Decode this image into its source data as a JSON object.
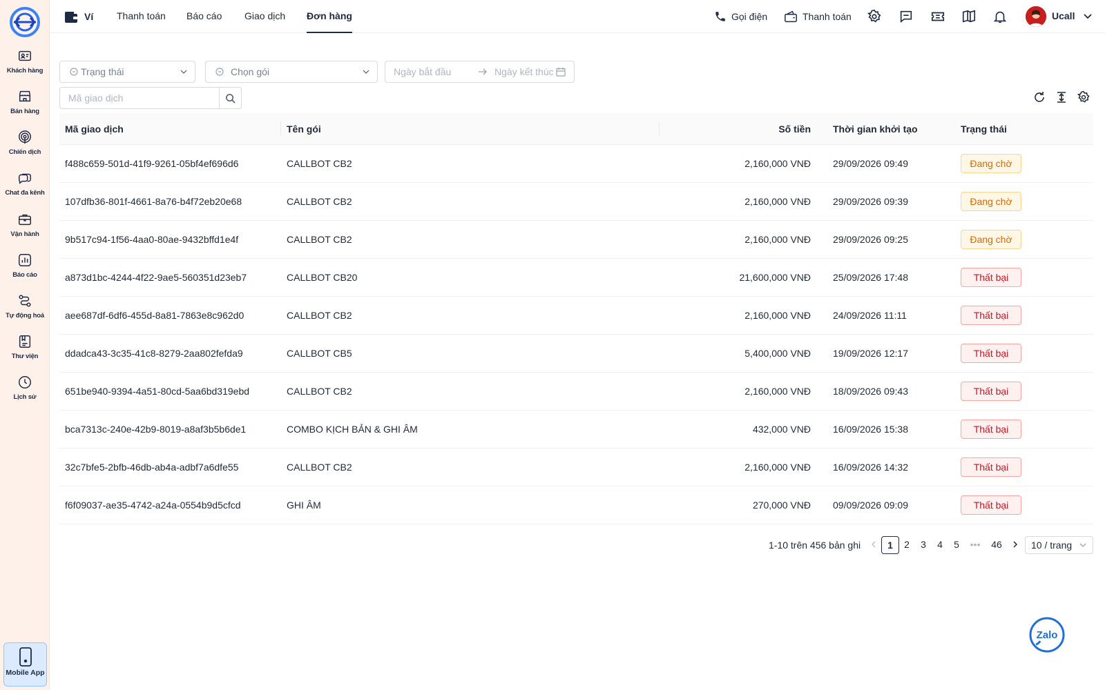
{
  "sidebar": {
    "items": [
      {
        "label": "Khách hàng",
        "icon": "customer-card-icon"
      },
      {
        "label": "Bán hàng",
        "icon": "store-icon"
      },
      {
        "label": "Chiến dịch",
        "icon": "broadcast-icon"
      },
      {
        "label": "Chat đa kênh",
        "icon": "chat-icon"
      },
      {
        "label": "Vận hành",
        "icon": "briefcase-icon"
      },
      {
        "label": "Báo cáo",
        "icon": "chart-icon"
      },
      {
        "label": "Tự động hoá",
        "icon": "automation-icon"
      },
      {
        "label": "Thư viện",
        "icon": "library-icon"
      },
      {
        "label": "Lịch sử",
        "icon": "clock-icon"
      }
    ],
    "mobile_app": "Mobile App"
  },
  "topnav": {
    "wallet": "Ví",
    "tabs": [
      "Thanh toán",
      "Báo cáo",
      "Giao dịch",
      "Đơn hàng"
    ],
    "active_tab": "Đơn hàng",
    "call": "Gọi điện",
    "payment": "Thanh toán",
    "user": "Ucall"
  },
  "filters": {
    "status_placeholder": "Trạng thái",
    "package_placeholder": "Chọn gói",
    "start_date_placeholder": "Ngày bắt đầu",
    "end_date_placeholder": "Ngày kết thúc",
    "search_placeholder": "Mã giao dịch"
  },
  "table": {
    "headers": [
      "Mã giao dịch",
      "Tên gói",
      "Số tiền",
      "Thời gian khởi tạo",
      "Trạng thái"
    ],
    "rows": [
      {
        "id": "f488c659-501d-41f9-9261-05bf4ef696d6",
        "package": "CALLBOT CB2",
        "amount": "2,160,000 VNĐ",
        "created": "29/09/2026 09:49",
        "status": "Đang chờ"
      },
      {
        "id": "107dfb36-801f-4661-8a76-b4f72eb20e68",
        "package": "CALLBOT CB2",
        "amount": "2,160,000 VNĐ",
        "created": "29/09/2026 09:39",
        "status": "Đang chờ"
      },
      {
        "id": "9b517c94-1f56-4aa0-80ae-9432bffd1e4f",
        "package": "CALLBOT CB2",
        "amount": "2,160,000 VNĐ",
        "created": "29/09/2026 09:25",
        "status": "Đang chờ"
      },
      {
        "id": "a873d1bc-4244-4f22-9ae5-560351d23eb7",
        "package": "CALLBOT CB20",
        "amount": "21,600,000 VNĐ",
        "created": "25/09/2026 17:48",
        "status": "Thất bại"
      },
      {
        "id": "aee687df-6df6-455d-8a81-7863e8c962d0",
        "package": "CALLBOT CB2",
        "amount": "2,160,000 VNĐ",
        "created": "24/09/2026 11:11",
        "status": "Thất bại"
      },
      {
        "id": "ddadca43-3c35-41c8-8279-2aa802fefda9",
        "package": "CALLBOT CB5",
        "amount": "5,400,000 VNĐ",
        "created": "19/09/2026 12:17",
        "status": "Thất bại"
      },
      {
        "id": "651be940-9394-4a51-80cd-5aa6bd319ebd",
        "package": "CALLBOT CB2",
        "amount": "2,160,000 VNĐ",
        "created": "18/09/2026 09:43",
        "status": "Thất bại"
      },
      {
        "id": "bca7313c-240e-42b9-8019-a8af3b5b6de1",
        "package": "COMBO KỊCH BẢN & GHI ÂM",
        "amount": "432,000 VNĐ",
        "created": "16/09/2026 15:38",
        "status": "Thất bại"
      },
      {
        "id": "32c7bfe5-2bfb-46db-ab4a-adbf7a6dfe55",
        "package": "CALLBOT CB2",
        "amount": "2,160,000 VNĐ",
        "created": "16/09/2026 14:32",
        "status": "Thất bại"
      },
      {
        "id": "f6f09037-ae35-4742-a24a-0554b9d5cfcd",
        "package": "GHI ÂM",
        "amount": "270,000 VNĐ",
        "created": "09/09/2026 09:09",
        "status": "Thất bại"
      }
    ]
  },
  "pagination": {
    "total": "1-10 trên 456 bản ghi",
    "pages": [
      "1",
      "2",
      "3",
      "4",
      "5",
      "•••",
      "46"
    ],
    "current": "1",
    "page_size": "10 / trang"
  },
  "colors": {
    "brand_navy": "#1e2a44",
    "sidebar_bg": "#fdf1ea",
    "pending": "#d46b08",
    "failed": "#cf1322"
  }
}
